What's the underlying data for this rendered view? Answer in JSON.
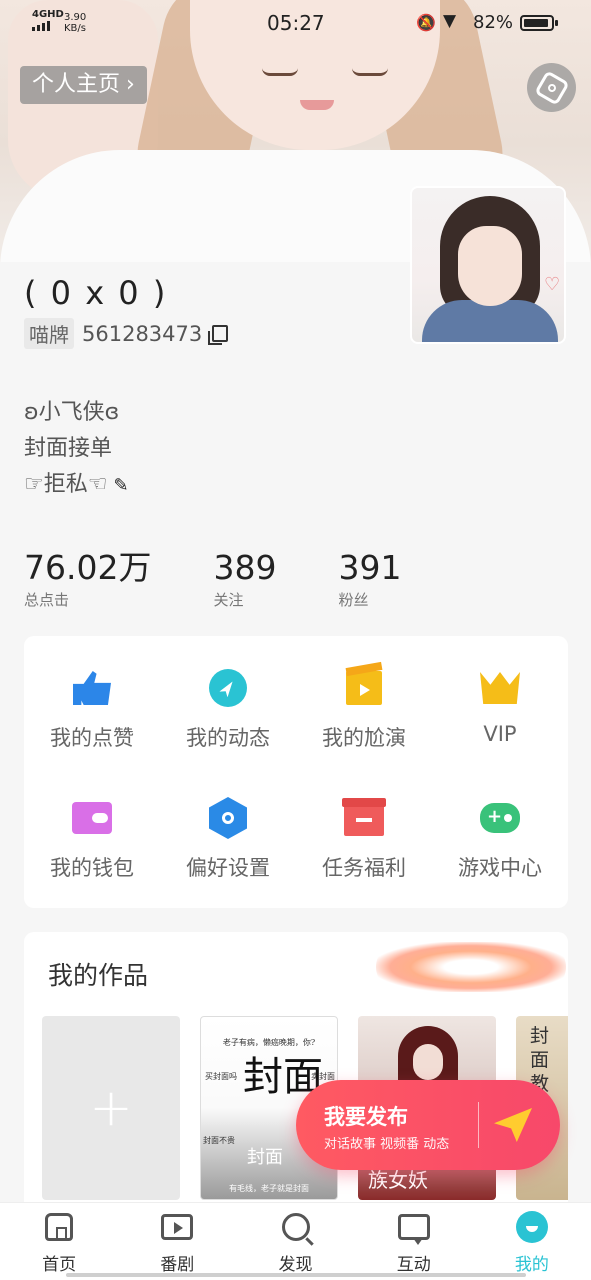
{
  "status_bar": {
    "network": "4GHD",
    "speed_value": "3.90",
    "speed_unit": "KB/s",
    "time": "05:27",
    "battery": "82%"
  },
  "header": {
    "homepage_label": "个人主页"
  },
  "profile": {
    "nickname": "( 0 x 0 )",
    "id_tag": "喵牌",
    "id_value": "561283473",
    "bio": [
      "ʚ小飞侠ɞ",
      "封面接单",
      "☞拒私☜"
    ]
  },
  "stats": [
    {
      "value": "76.02万",
      "label": "总点击"
    },
    {
      "value": "389",
      "label": "关注"
    },
    {
      "value": "391",
      "label": "粉丝"
    }
  ],
  "menu": [
    {
      "label": "我的点赞",
      "icon": "thumbs-up-icon"
    },
    {
      "label": "我的动态",
      "icon": "compass-icon"
    },
    {
      "label": "我的尬演",
      "icon": "clapperboard-icon"
    },
    {
      "label": "VIP",
      "icon": "crown-icon"
    },
    {
      "label": "我的钱包",
      "icon": "wallet-icon"
    },
    {
      "label": "偏好设置",
      "icon": "hexagon-settings-icon"
    },
    {
      "label": "任务福利",
      "icon": "gift-box-icon"
    },
    {
      "label": "游戏中心",
      "icon": "gamepad-icon"
    }
  ],
  "works": {
    "title": "我的作品",
    "add_symbol": "+",
    "tile1": {
      "top_text": "老子有病，懒癌晚期，你?",
      "left_text": "买封面吗",
      "right_text": "卖封面",
      "big": "封面",
      "bottom_left": "封面不贵",
      "caption": "封面",
      "footer": "有毛线，老子就是封面"
    },
    "tile2": {
      "caption": "族女妖"
    },
    "tile3": {
      "text": "封面教"
    }
  },
  "publish": {
    "title": "我要发布",
    "subtitle": "对话故事 视频番 动态"
  },
  "tabs": [
    {
      "label": "首页",
      "icon": "home-icon"
    },
    {
      "label": "番剧",
      "icon": "play-icon"
    },
    {
      "label": "发现",
      "icon": "search-icon"
    },
    {
      "label": "互动",
      "icon": "chat-icon"
    },
    {
      "label": "我的",
      "icon": "me-icon",
      "active": true
    }
  ],
  "colors": {
    "accent": "#2ac3d3",
    "publish": "#f7486a"
  }
}
